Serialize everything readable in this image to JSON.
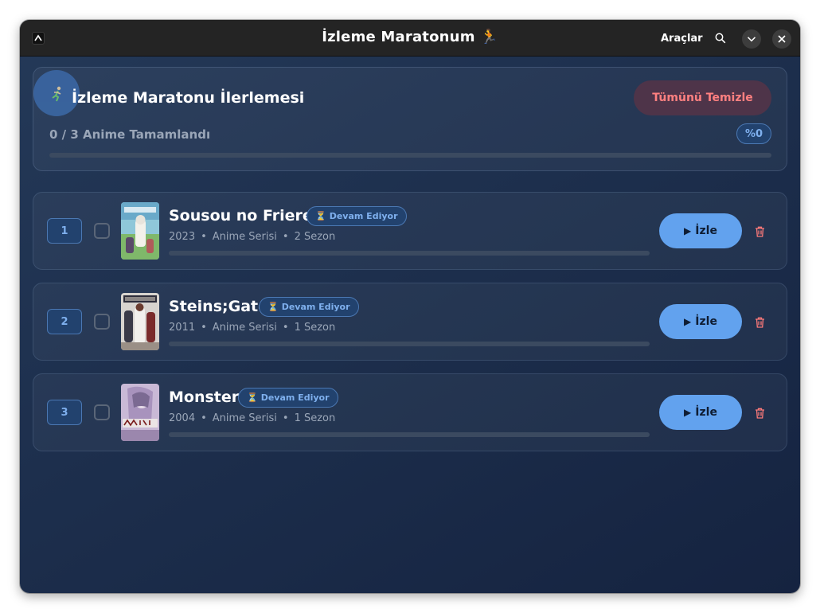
{
  "window": {
    "title": "İzleme Maratonum",
    "title_emoji": "🏃",
    "tools_label": "Araçlar"
  },
  "icons": {
    "app": "app-logo-icon",
    "search": "search-icon",
    "minimize": "chevron-down-icon",
    "close": "close-icon",
    "runner": "runner-icon",
    "hourglass": "hourglass-icon",
    "play": "play-icon",
    "delete": "trash-icon"
  },
  "progress_card": {
    "title": "İzleme Maratonu İlerlemesi",
    "clear_label": "Tümünü Temizle",
    "count_text": "0 / 3 Anime Tamamlandı",
    "percent_label": "%0",
    "progress_fraction": 0
  },
  "items": [
    {
      "index": "1",
      "title": "Sousou no Frieren",
      "status": "Devam Ediyor",
      "year": "2023",
      "type": "Anime Serisi",
      "seasons": "2 Sezon",
      "watch_label": "İzle",
      "checked": false,
      "progress_fraction": 0
    },
    {
      "index": "2",
      "title": "Steins;Gate",
      "status": "Devam Ediyor",
      "year": "2011",
      "type": "Anime Serisi",
      "seasons": "1 Sezon",
      "watch_label": "İzle",
      "checked": false,
      "progress_fraction": 0
    },
    {
      "index": "3",
      "title": "Monster",
      "status": "Devam Ediyor",
      "year": "2004",
      "type": "Anime Serisi",
      "seasons": "1 Sezon",
      "watch_label": "İzle",
      "checked": false,
      "progress_fraction": 0
    }
  ],
  "colors": {
    "accent": "#62a2ee",
    "danger": "#ff8080",
    "badge_text": "#7fb0ee",
    "background": "#1d2f4d"
  }
}
